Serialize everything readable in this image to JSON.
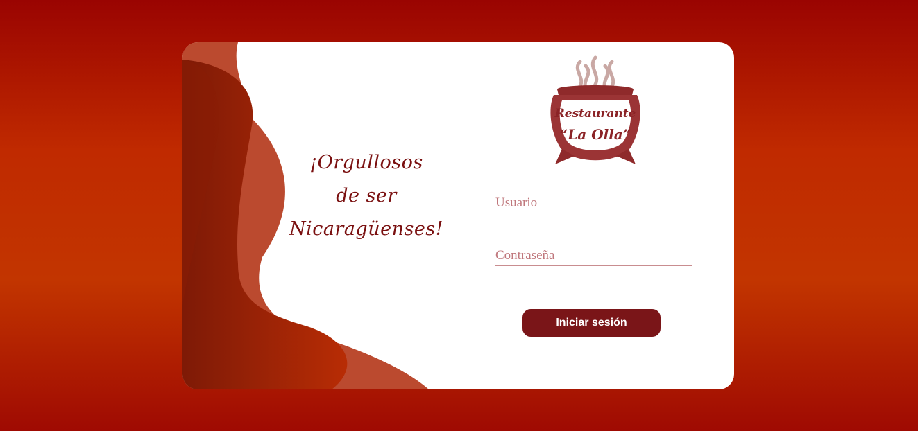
{
  "slogan": {
    "line1": "¡Orgullosos",
    "line2": "de ser",
    "line3": "Nicaragüenses!"
  },
  "logo": {
    "line1": "Restaurante",
    "line2": "“La Olla”",
    "icon": "cooking-pot-with-steam"
  },
  "form": {
    "username_placeholder": "Usuario",
    "password_placeholder": "Contraseña",
    "submit_label": "Iniciar sesión"
  },
  "colors": {
    "background": "#c23500",
    "accent": "#7a1518",
    "field_line": "#c98d90",
    "placeholder": "#c0787d"
  }
}
